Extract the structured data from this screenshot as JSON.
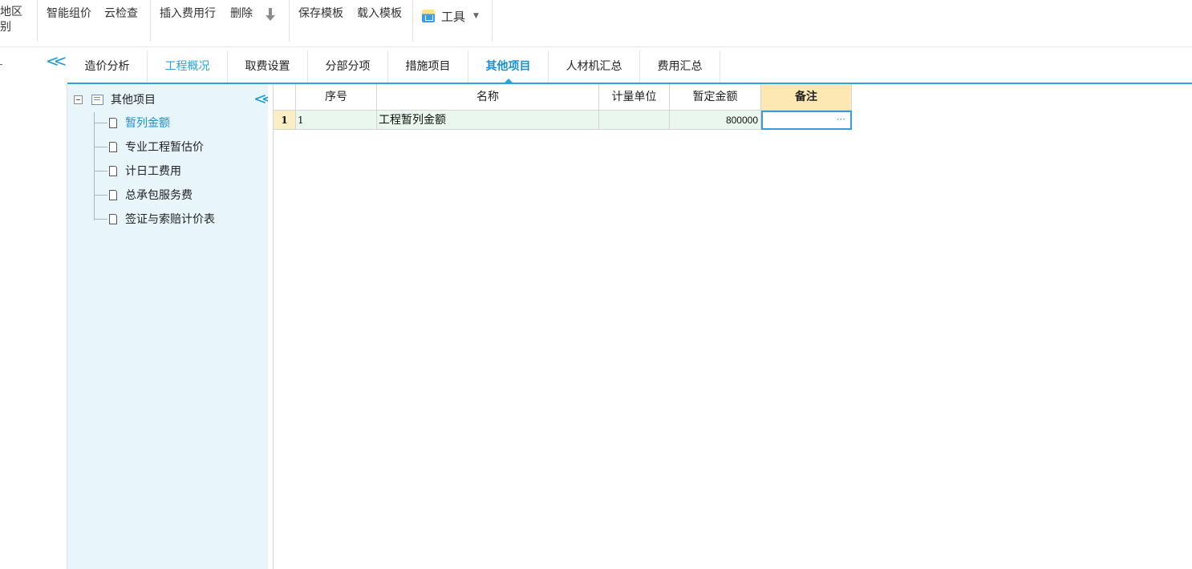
{
  "toolbar": {
    "region_line1": "地区",
    "region_line2": "别",
    "smart_pricing": "智能组价",
    "cloud_check": "云检查",
    "insert_fee_row": "插入费用行",
    "delete": "删除",
    "save_template": "保存模板",
    "load_template": "载入模板",
    "tools": "工具"
  },
  "tabs": [
    {
      "label": "造价分析"
    },
    {
      "label": "工程概况"
    },
    {
      "label": "取费设置"
    },
    {
      "label": "分部分项"
    },
    {
      "label": "措施项目"
    },
    {
      "label": "其他项目"
    },
    {
      "label": "人材机汇总"
    },
    {
      "label": "费用汇总"
    }
  ],
  "active_tab": "其他项目",
  "tree": {
    "root": "其他项目",
    "children": [
      {
        "label": "暂列金额",
        "selected": true
      },
      {
        "label": "专业工程暂估价"
      },
      {
        "label": "计日工费用"
      },
      {
        "label": "总承包服务费"
      },
      {
        "label": "签证与索赔计价表"
      }
    ]
  },
  "grid": {
    "columns": [
      "序号",
      "名称",
      "计量单位",
      "暂定金额",
      "备注"
    ],
    "rows": [
      {
        "row_no": "1",
        "seq": "1",
        "name": "工程暂列金额",
        "unit": "",
        "amount": "800000",
        "note": "···"
      }
    ]
  },
  "colors": {
    "accent": "#2aa3df",
    "tree_bg": "#e8f6fc",
    "note_header_bg": "#fde7b3",
    "row_bg": "#eaf7ef"
  }
}
